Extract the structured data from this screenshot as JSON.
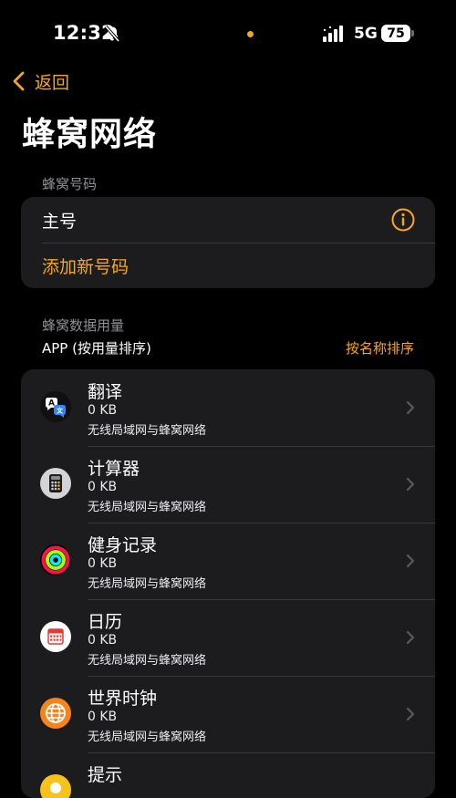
{
  "status": {
    "time": "12:32",
    "network": "5G",
    "battery": "75"
  },
  "nav": {
    "back_label": "返回"
  },
  "page": {
    "title": "蜂窝网络"
  },
  "numbers_section": {
    "header": "蜂窝号码",
    "primary_label": "主号",
    "add_label": "添加新号码"
  },
  "usage_section": {
    "header": "蜂窝数据用量",
    "apps_label": "APP (按用量排序)",
    "sort_label": "按名称排序"
  },
  "apps": [
    {
      "name": "翻译",
      "usage": "0 KB",
      "network": "无线局域网与蜂窝网络",
      "icon": "translate-icon"
    },
    {
      "name": "计算器",
      "usage": "0 KB",
      "network": "无线局域网与蜂窝网络",
      "icon": "calculator-icon"
    },
    {
      "name": "健身记录",
      "usage": "0 KB",
      "network": "无线局域网与蜂窝网络",
      "icon": "activity-icon"
    },
    {
      "name": "日历",
      "usage": "0 KB",
      "network": "无线局域网与蜂窝网络",
      "icon": "calendar-icon"
    },
    {
      "name": "世界时钟",
      "usage": "0 KB",
      "network": "无线局域网与蜂窝网络",
      "icon": "world-clock-icon"
    },
    {
      "name": "提示",
      "usage": "",
      "network": "",
      "icon": "tips-icon"
    }
  ],
  "colors": {
    "accent": "#f5a623",
    "background": "#000000",
    "card": "#1c1c1e",
    "secondary_text": "#8e8e93"
  }
}
